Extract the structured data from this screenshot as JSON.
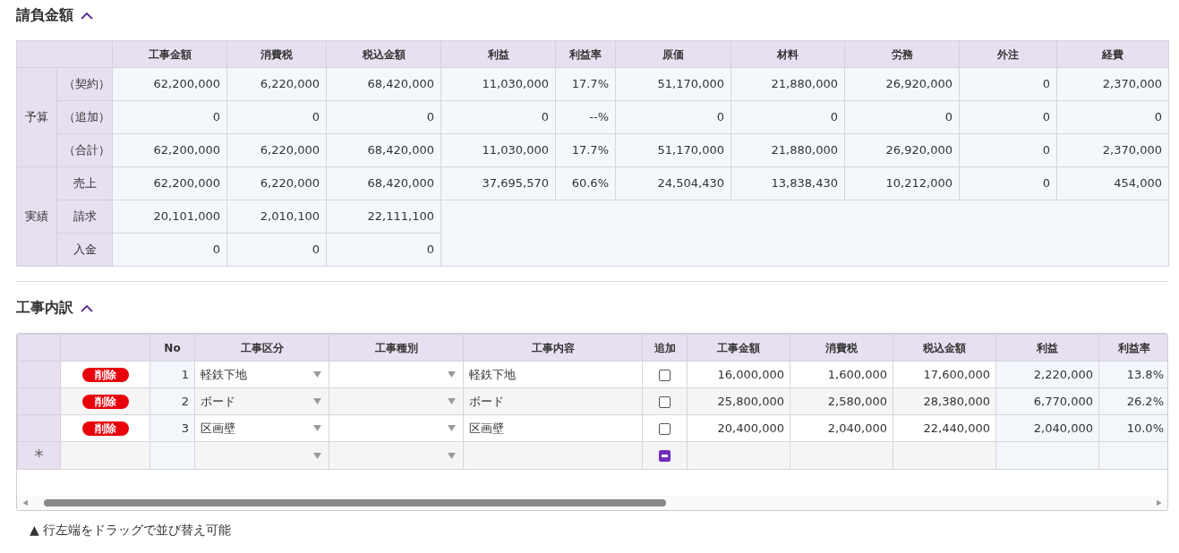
{
  "contract": {
    "title": "請負金額",
    "expanded": true,
    "columns": [
      "工事金額",
      "消費税",
      "税込金額",
      "利益",
      "利益率",
      "原価",
      "材料",
      "労務",
      "外注",
      "経費"
    ],
    "groups": [
      {
        "label": "予算",
        "rows": [
          {
            "label": "（契約）",
            "values": [
              "62,200,000",
              "6,220,000",
              "68,420,000",
              "11,030,000",
              "17.7%",
              "51,170,000",
              "21,880,000",
              "26,920,000",
              "0",
              "2,370,000"
            ]
          },
          {
            "label": "（追加）",
            "values": [
              "0",
              "0",
              "0",
              "0",
              "--%",
              "0",
              "0",
              "0",
              "0",
              "0"
            ]
          },
          {
            "label": "（合計）",
            "values": [
              "62,200,000",
              "6,220,000",
              "68,420,000",
              "11,030,000",
              "17.7%",
              "51,170,000",
              "21,880,000",
              "26,920,000",
              "0",
              "2,370,000"
            ]
          }
        ]
      },
      {
        "label": "実績",
        "rows": [
          {
            "label": "売上",
            "values": [
              "62,200,000",
              "6,220,000",
              "68,420,000",
              "37,695,570",
              "60.6%",
              "24,504,430",
              "13,838,430",
              "10,212,000",
              "0",
              "454,000"
            ]
          },
          {
            "label": "請求",
            "values": [
              "20,101,000",
              "2,010,100",
              "22,111,100"
            ]
          },
          {
            "label": "入金",
            "values": [
              "0",
              "0",
              "0"
            ]
          }
        ]
      }
    ]
  },
  "breakdown": {
    "title": "工事内訳",
    "expanded": true,
    "columns": [
      "No",
      "工事区分",
      "工事種別",
      "工事内容",
      "追加",
      "工事金額",
      "消費税",
      "税込金額",
      "利益",
      "利益率"
    ],
    "rows": [
      {
        "kind": "entry",
        "delete_label": "削除",
        "no": "1",
        "category": "軽鉄下地",
        "content": "軽鉄下地",
        "checked": false,
        "indeterminate": false,
        "amount": "16,000,000",
        "tax": "1,600,000",
        "total": "17,600,000",
        "profit": "2,220,000",
        "rate": "13.8%"
      },
      {
        "kind": "entry",
        "delete_label": "削除",
        "no": "2",
        "category": "ボード",
        "content": "ボード",
        "checked": false,
        "indeterminate": false,
        "amount": "25,800,000",
        "tax": "2,580,000",
        "total": "28,380,000",
        "profit": "6,770,000",
        "rate": "26.2%"
      },
      {
        "kind": "entry",
        "delete_label": "削除",
        "no": "3",
        "category": "区画壁",
        "content": "区画壁",
        "checked": false,
        "indeterminate": false,
        "amount": "20,400,000",
        "tax": "2,040,000",
        "total": "22,440,000",
        "profit": "2,040,000",
        "rate": "10.0%"
      },
      {
        "kind": "new",
        "marker": "*",
        "indeterminate": true
      }
    ],
    "note": "▲ 行左端をドラッグで並び替え可能"
  }
}
